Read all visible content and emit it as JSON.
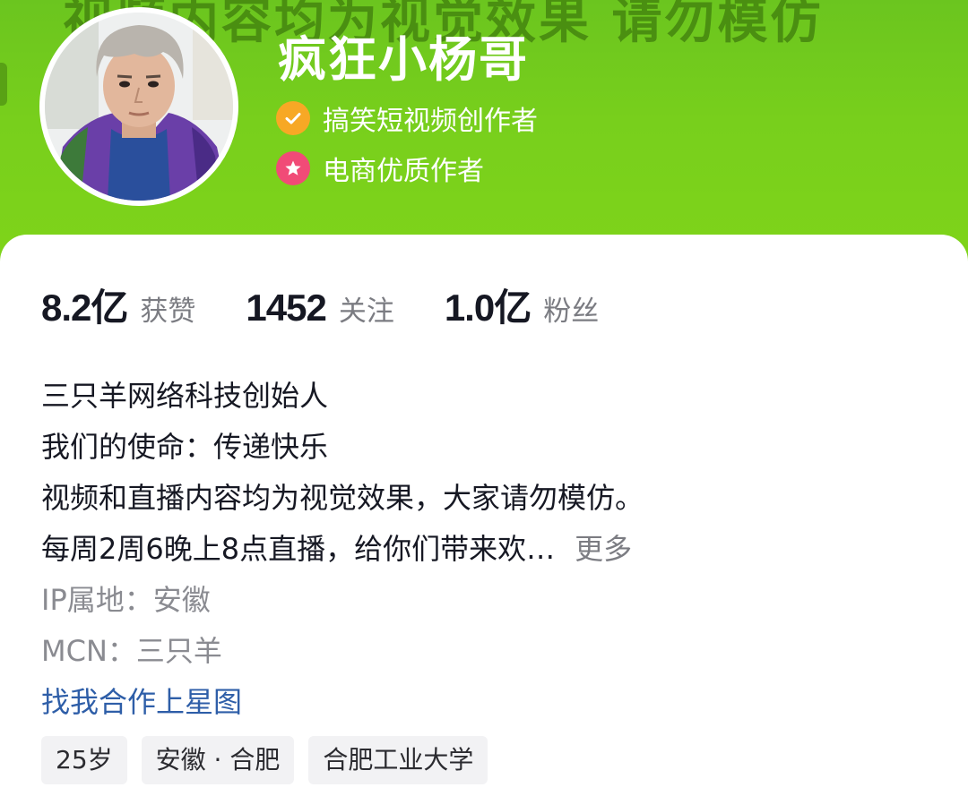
{
  "banner": {
    "watermark": "视频内容均为视觉效果 请勿模仿"
  },
  "profile": {
    "nickname": "疯狂小杨哥",
    "avatar_icon": "avatar-photo",
    "badges": [
      {
        "icon": "check-icon",
        "color": "#f7a825",
        "label": "搞笑短视频创作者"
      },
      {
        "icon": "star-icon",
        "color": "#f14b77",
        "label": "电商优质作者"
      }
    ]
  },
  "stats": [
    {
      "value": "8.2亿",
      "label": "获赞"
    },
    {
      "value": "1452",
      "label": "关注"
    },
    {
      "value": "1.0亿",
      "label": "粉丝"
    }
  ],
  "bio": {
    "lines": [
      "三只羊网络科技创始人",
      "我们的使命：传递快乐",
      "视频和直播内容均为视觉效果，大家请勿模仿。",
      "每周2周6晚上8点直播，给你们带来欢…"
    ],
    "more_label": "更多"
  },
  "info": {
    "ip_location": "IP属地：安徽",
    "mcn": "MCN：三只羊"
  },
  "star_map_link": "找我合作上星图",
  "tags": [
    "25岁",
    "安徽 · 合肥",
    "合肥工业大学"
  ],
  "colors": {
    "banner_green": "#78cf1c",
    "link_blue": "#2e5ea8",
    "muted_text": "#7b7c82"
  }
}
